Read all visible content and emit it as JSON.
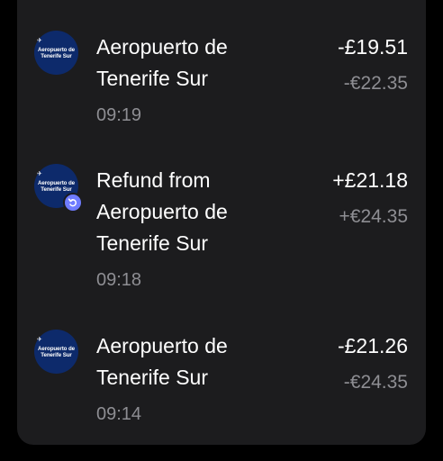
{
  "transactions": [
    {
      "merchant": "Aeropuerto de\nTenerife Sur",
      "time": "09:19",
      "amount_gbp": "-£19.51",
      "amount_eur": "-€22.35",
      "logo_text": "Aeropuerto de\nTenerife Sur",
      "icon": "airport-logo-icon"
    },
    {
      "merchant": "Refund from\nAeropuerto de\nTenerife Sur",
      "time": "09:18",
      "amount_gbp": "+£21.18",
      "amount_eur": "+€24.35",
      "logo_text": "Aeropuerto de\nTenerife Sur",
      "icon": "airport-logo-icon",
      "badge_icon": "refund-icon"
    },
    {
      "merchant": "Aeropuerto de\nTenerife Sur",
      "time": "09:14",
      "amount_gbp": "-£21.26",
      "amount_eur": "-€24.35",
      "logo_text": "Aeropuerto de\nTenerife Sur",
      "icon": "airport-logo-icon"
    }
  ],
  "colors": {
    "background": "#000000",
    "card": "#1c1c1e",
    "primary_text": "#ffffff",
    "secondary_text": "#8e8e93",
    "logo_bg": "#0d2a6b",
    "refund_badge": "#6f7cff"
  }
}
